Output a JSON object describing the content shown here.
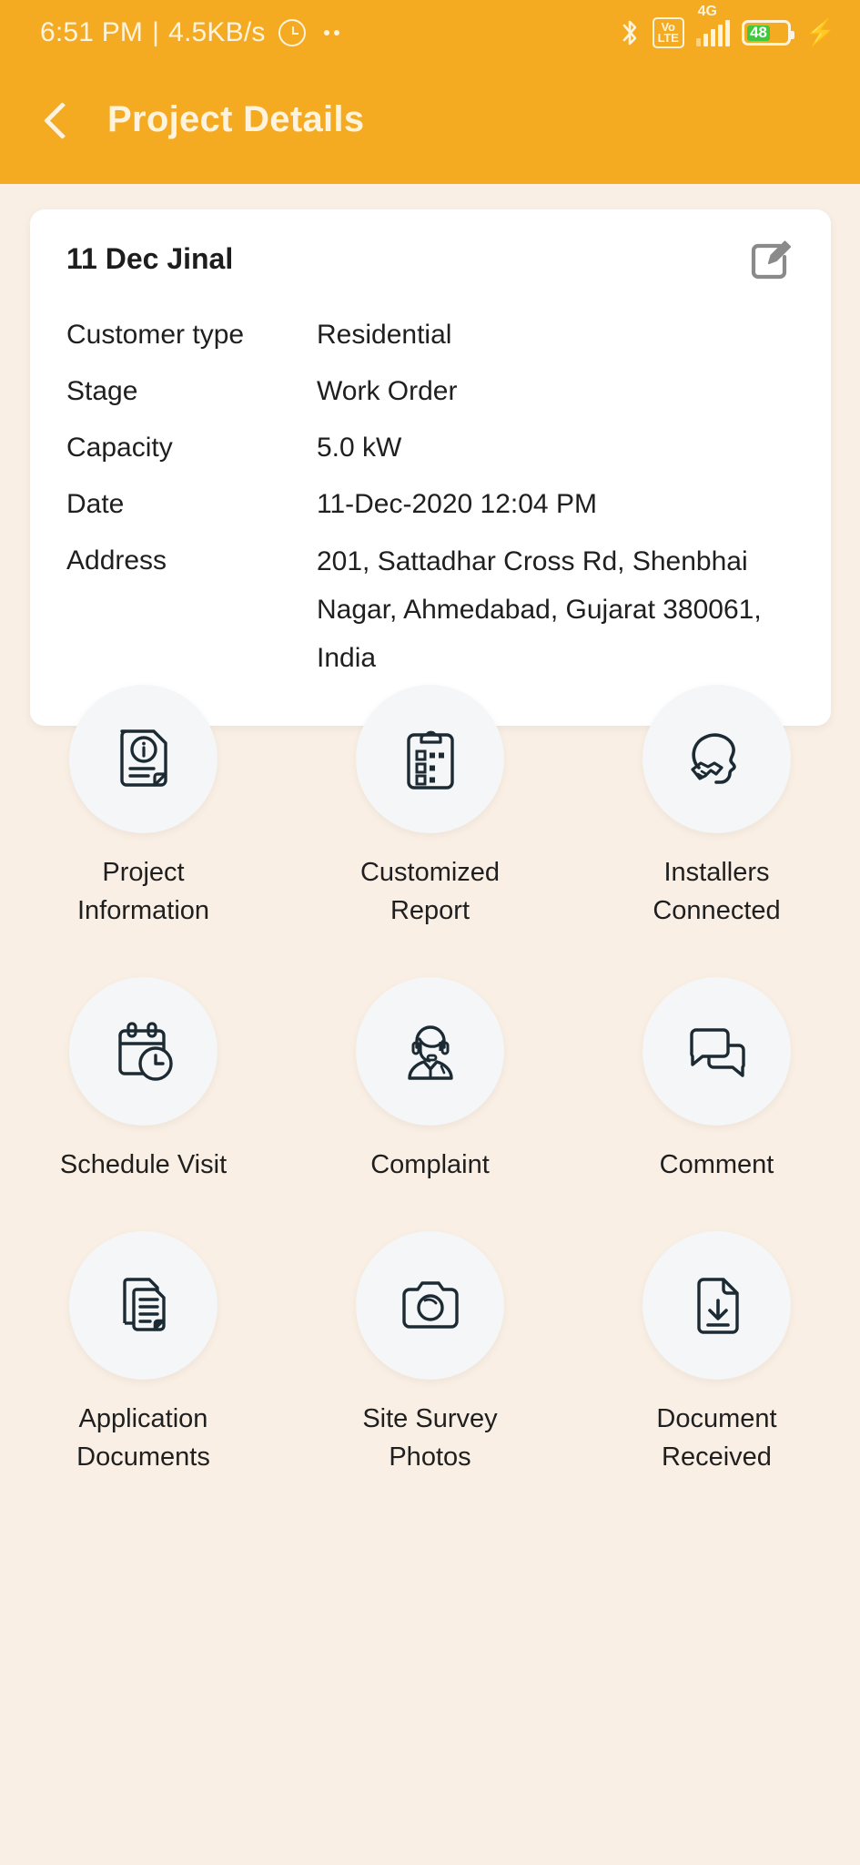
{
  "status_bar": {
    "time": "6:51 PM",
    "separator": "|",
    "network_speed": "4.5KB/s",
    "alarm_icon": "alarm-icon",
    "dots_icon": "more-dots-icon",
    "bluetooth_icon": "bluetooth-icon",
    "volte_label_top": "Vo",
    "volte_label_bottom": "LTE",
    "network_type": "4G",
    "signal_icon": "signal-bars-icon",
    "battery_percent": "48",
    "charging_icon": "charging-bolt-icon"
  },
  "app_bar": {
    "back_icon": "back-chevron-icon",
    "title": "Project Details"
  },
  "card": {
    "title": "11 Dec Jinal",
    "edit_icon": "edit-pencil-icon",
    "details": [
      {
        "label": "Customer type",
        "value": "Residential"
      },
      {
        "label": "Stage",
        "value": "Work Order"
      },
      {
        "label": "Capacity",
        "value": "5.0 kW"
      },
      {
        "label": "Date",
        "value": "11-Dec-2020 12:04 PM"
      },
      {
        "label": "Address",
        "value": "201, Sattadhar Cross Rd, Shenbhai Nagar, Ahmedabad, Gujarat 380061, India"
      }
    ]
  },
  "grid": {
    "tiles": [
      {
        "label": "Project\nInformation",
        "icon": "document-info-icon"
      },
      {
        "label": "Customized\nReport",
        "icon": "clipboard-checklist-icon"
      },
      {
        "label": "Installers\nConnected",
        "icon": "handshake-head-icon"
      },
      {
        "label": "Schedule Visit",
        "icon": "calendar-clock-icon"
      },
      {
        "label": "Complaint",
        "icon": "support-agent-icon"
      },
      {
        "label": "Comment",
        "icon": "chat-bubbles-icon"
      },
      {
        "label": "Application\nDocuments",
        "icon": "documents-stack-icon"
      },
      {
        "label": "Site Survey\nPhotos",
        "icon": "camera-icon"
      },
      {
        "label": "Document\nReceived",
        "icon": "document-download-icon"
      }
    ]
  },
  "colors": {
    "brand_orange": "#f4ab21",
    "page_background": "#faefe4",
    "card_background": "#ffffff",
    "icon_stroke": "#1b2a33",
    "battery_fill": "#3ec93e",
    "status_text": "#fdf3de"
  }
}
